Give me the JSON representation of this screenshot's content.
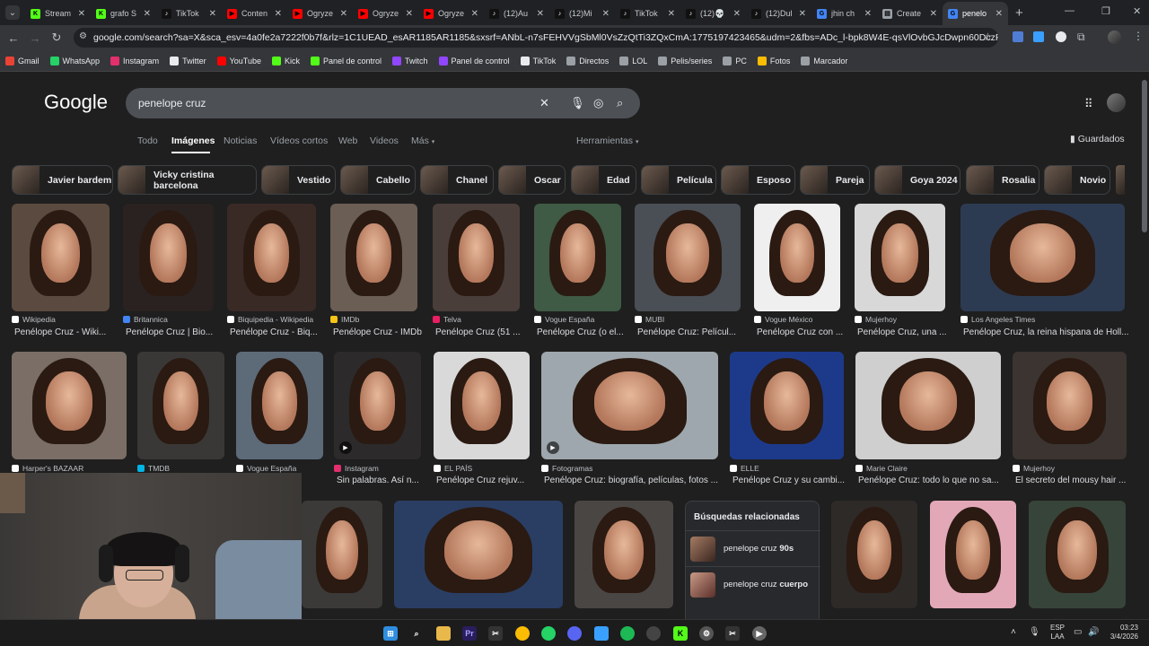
{
  "tabs": [
    {
      "label": "Stream",
      "color": "#53fc18",
      "glyph": "K"
    },
    {
      "label": "grafo S",
      "color": "#53fc18",
      "glyph": "K"
    },
    {
      "label": "TikTok",
      "color": "#111111",
      "glyph": "♪"
    },
    {
      "label": "Conten",
      "color": "#ff0000",
      "glyph": "▶"
    },
    {
      "label": "Ogryze",
      "color": "#ff0000",
      "glyph": "▶"
    },
    {
      "label": "Ogryze",
      "color": "#ff0000",
      "glyph": "▶"
    },
    {
      "label": "Ogryze",
      "color": "#ff0000",
      "glyph": "▶"
    },
    {
      "label": "(12)Au",
      "color": "#111111",
      "glyph": "♪"
    },
    {
      "label": "(12)Mi",
      "color": "#111111",
      "glyph": "♪"
    },
    {
      "label": "TikTok",
      "color": "#111111",
      "glyph": "♪"
    },
    {
      "label": "(12)💀",
      "color": "#111111",
      "glyph": "♪"
    },
    {
      "label": "(12)Dul",
      "color": "#111111",
      "glyph": "♪"
    },
    {
      "label": "jhin ch",
      "color": "#4285f4",
      "glyph": "G"
    },
    {
      "label": "Create",
      "color": "#9aa0a6",
      "glyph": "▤"
    },
    {
      "label": "penelo",
      "color": "#4285f4",
      "glyph": "G",
      "active": true
    }
  ],
  "omnibox": {
    "url": "google.com/search?sa=X&sca_esv=4a0fe2a7222f0b7f&rlz=1C1UEAD_esAR1185AR1185&sxsrf=ANbL-n7sFEHVVgSbMl0VsZzQtTi3ZQxCmA:1775197423465&udm=2&fbs=ADc_l-bpk8W4E-qsVlOvbGJcDwpn60DczFdcvPnuv8WQohHLTbSVI..."
  },
  "bookmarks": [
    {
      "label": "Gmail",
      "color": "#ea4335"
    },
    {
      "label": "WhatsApp",
      "color": "#25d366"
    },
    {
      "label": "Instagram",
      "color": "#e1306c"
    },
    {
      "label": "Twitter",
      "color": "#e8eaed"
    },
    {
      "label": "YouTube",
      "color": "#ff0000"
    },
    {
      "label": "Kick",
      "color": "#53fc18"
    },
    {
      "label": "Panel de control",
      "color": "#53fc18"
    },
    {
      "label": "Twitch",
      "color": "#9146ff"
    },
    {
      "label": "Panel de control",
      "color": "#9146ff"
    },
    {
      "label": "TikTok",
      "color": "#e8eaed"
    },
    {
      "label": "Directos",
      "color": "#9aa0a6"
    },
    {
      "label": "LOL",
      "color": "#9aa0a6"
    },
    {
      "label": "Pelis/series",
      "color": "#9aa0a6"
    },
    {
      "label": "PC",
      "color": "#9aa0a6"
    },
    {
      "label": "Fotos",
      "color": "#fbbc04"
    },
    {
      "label": "Marcador",
      "color": "#9aa0a6"
    }
  ],
  "search": {
    "logo": "Google",
    "query": "penelope cruz"
  },
  "nav": {
    "all": "Todo",
    "images": "Imágenes",
    "news": "Noticias",
    "short_videos": "Vídeos cortos",
    "web": "Web",
    "videos": "Videos",
    "more": "Más",
    "tools": "Herramientas",
    "saved": "Guardados"
  },
  "chips": [
    "Javier bardem",
    "Vicky cristina barcelona",
    "Vestido",
    "Cabello",
    "Chanel",
    "Oscar",
    "Edad",
    "Película",
    "Esposo",
    "Pareja",
    "Goya 2024",
    "Rosalia",
    "Novio"
  ],
  "row1": [
    {
      "source": "Wikipedia",
      "title": "Penélope Cruz - Wiki...",
      "color": "#ffffff"
    },
    {
      "source": "Britannica",
      "title": "Penélope Cruz | Bio...",
      "color": "#4285f4"
    },
    {
      "source": "Biquipedia - Wikipedia",
      "title": "Penélope Cruz - Biq...",
      "color": "#ffffff"
    },
    {
      "source": "IMDb",
      "title": "Penélope Cruz - IMDb",
      "color": "#f5c518"
    },
    {
      "source": "Telva",
      "title": "Penélope Cruz (51 ...",
      "color": "#e91e63"
    },
    {
      "source": "Vogue España",
      "title": "Penélope Cruz (o el...",
      "color": "#ffffff"
    },
    {
      "source": "MUBI",
      "title": "Penélope Cruz: Películ...",
      "color": "#ffffff"
    },
    {
      "source": "Vogue México",
      "title": "Penélope Cruz con ...",
      "color": "#ffffff"
    },
    {
      "source": "Mujerhoy",
      "title": "Penélope Cruz, una ...",
      "color": "#ffffff"
    },
    {
      "source": "Los Angeles Times",
      "title": "Penélope Cruz, la reina hispana de Holl...",
      "color": "#ffffff"
    }
  ],
  "row2": [
    {
      "source": "Harper's BAZAAR",
      "title": "",
      "color": "#ffffff"
    },
    {
      "source": "TMDB",
      "title": "",
      "color": "#01b4e4"
    },
    {
      "source": "Vogue España",
      "title": "",
      "color": "#ffffff"
    },
    {
      "source": "Instagram",
      "title": "Sin palabras. Así n...",
      "color": "#e1306c"
    },
    {
      "source": "EL PAÍS",
      "title": "Penélope Cruz rejuv...",
      "color": "#ffffff"
    },
    {
      "source": "Fotogramas",
      "title": "Penélope Cruz: biografía, películas, fotos ...",
      "color": "#ffffff"
    },
    {
      "source": "ELLE",
      "title": "Penélope Cruz y su cambi...",
      "color": "#ffffff"
    },
    {
      "source": "Marie Claire",
      "title": "Penélope Cruz: todo lo que no sa...",
      "color": "#ffffff"
    },
    {
      "source": "Mujerhoy",
      "title": "El secreto del mousy hair ...",
      "color": "#ffffff"
    }
  ],
  "related": {
    "heading": "Búsquedas relacionadas",
    "items": [
      {
        "prefix": "penelope cruz ",
        "bold": "90s"
      },
      {
        "prefix": "penelope cruz ",
        "bold": "cuerpo"
      }
    ]
  },
  "system": {
    "lang": "ESP",
    "lang2": "LAA",
    "time": "03:23",
    "date": "3/4/2026"
  }
}
